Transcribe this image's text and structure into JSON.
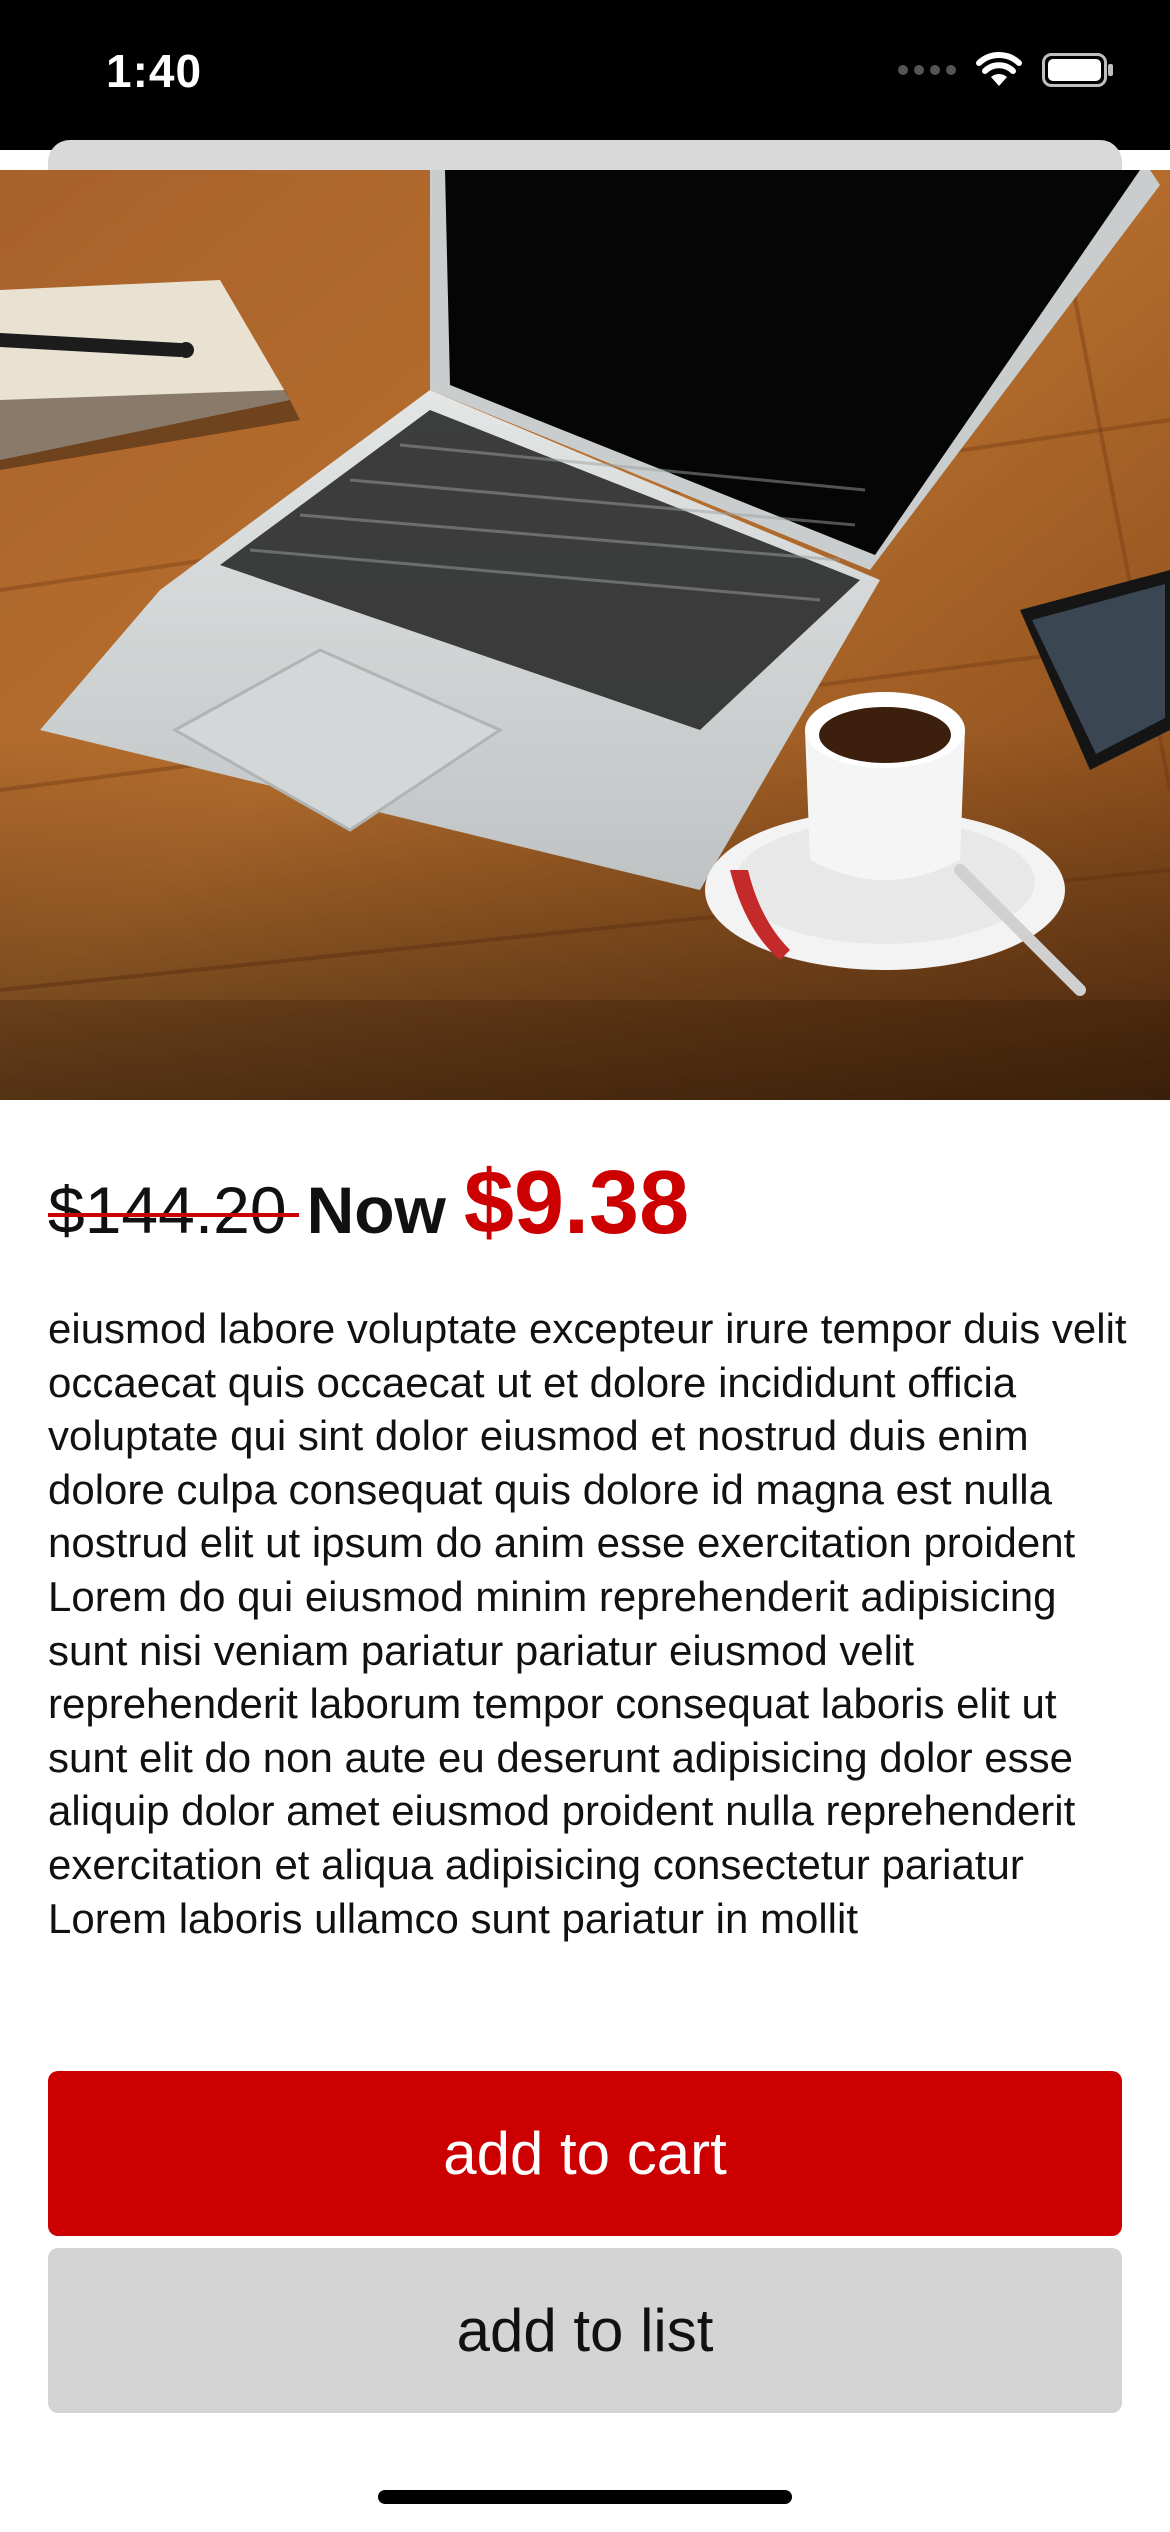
{
  "status_bar": {
    "time": "1:40"
  },
  "product": {
    "image_alt": "Laptop on a wooden desk with a cup of coffee",
    "old_price": "$144.20",
    "now_label": "Now",
    "new_price": "$9.38",
    "description": "eiusmod labore voluptate excepteur irure tempor duis velit occaecat quis occaecat ut et dolore incididunt officia voluptate qui sint dolor eiusmod et nostrud duis enim dolore culpa consequat quis dolore id magna est nulla nostrud elit ut ipsum do anim esse exercitation proident Lorem do qui eiusmod minim reprehenderit adipisicing sunt nisi veniam pariatur pariatur eiusmod velit reprehenderit laborum tempor consequat laboris elit ut sunt elit do non aute eu deserunt adipisicing dolor esse aliquip dolor amet eiusmod proident nulla reprehenderit exercitation et aliqua adipisicing consectetur pariatur Lorem laboris ullamco sunt pariatur in mollit"
  },
  "actions": {
    "add_to_cart": "add to cart",
    "add_to_list": "add to list"
  },
  "colors": {
    "accent": "#cc0000",
    "secondary_button": "#d4d4d4",
    "status_bar": "#000000"
  },
  "icons": {
    "signal": "cellular-signal-icon",
    "wifi": "wifi-icon",
    "battery": "battery-icon"
  }
}
